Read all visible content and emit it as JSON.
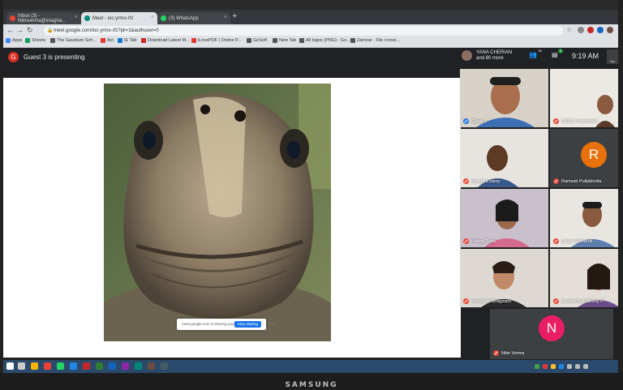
{
  "browser": {
    "tabs": [
      {
        "label": "Inbox (3) - Nitinverma@iniagha..."
      },
      {
        "label": "Meet - ioc-yrmo-rfz"
      },
      {
        "label": "(3) WhatsApp"
      }
    ],
    "url": "meet.google.com/ioc-yrmo-rfz?pli=1&authuser=0",
    "bookmarks": [
      {
        "label": "Apps"
      },
      {
        "label": "Sheets"
      },
      {
        "label": "The Gaudium Sch..."
      },
      {
        "label": "Act"
      },
      {
        "label": "IE Tab"
      },
      {
        "label": "Download Latest M..."
      },
      {
        "label": "iLovePDF | Online P..."
      },
      {
        "label": "GoSoft"
      },
      {
        "label": "New Tab"
      },
      {
        "label": "All logos (PNG) - Go..."
      },
      {
        "label": "Zamzar - File conve..."
      }
    ]
  },
  "meet": {
    "presenter_initial": "G",
    "presenter_text": "Guest 3 is presenting",
    "share_bar_text": "meet.google.com is sharing your screen.",
    "stop_sharing_label": "Stop sharing",
    "hide_label": "Hide",
    "header": {
      "user_name": "YANA CHERIAN",
      "user_more": "and 80 more",
      "people_count": "82",
      "chat_badge": "3",
      "time": "9:19 AM",
      "you_label": "You"
    },
    "participants": [
      {
        "name": "Guest 3"
      },
      {
        "name": "CBSE Coordinator"
      },
      {
        "name": "Karuppa samy"
      },
      {
        "name": "Ramesh Pullabhotla",
        "initial": "R"
      },
      {
        "name": "Rekha Dass"
      },
      {
        "name": "Lavan Kumarati"
      },
      {
        "name": "Karishma Bhagwani"
      },
      {
        "name": "Leena Chakraborty P"
      },
      {
        "name": "Nitin Verma",
        "initial": "N"
      }
    ]
  },
  "monitor": {
    "brand": "SAMSUNG"
  },
  "colors": {
    "accent": "#1a73e8",
    "muted_red": "#ea4335",
    "ramesh_avatar": "#e8710a",
    "nitin_avatar": "#e91e63"
  }
}
